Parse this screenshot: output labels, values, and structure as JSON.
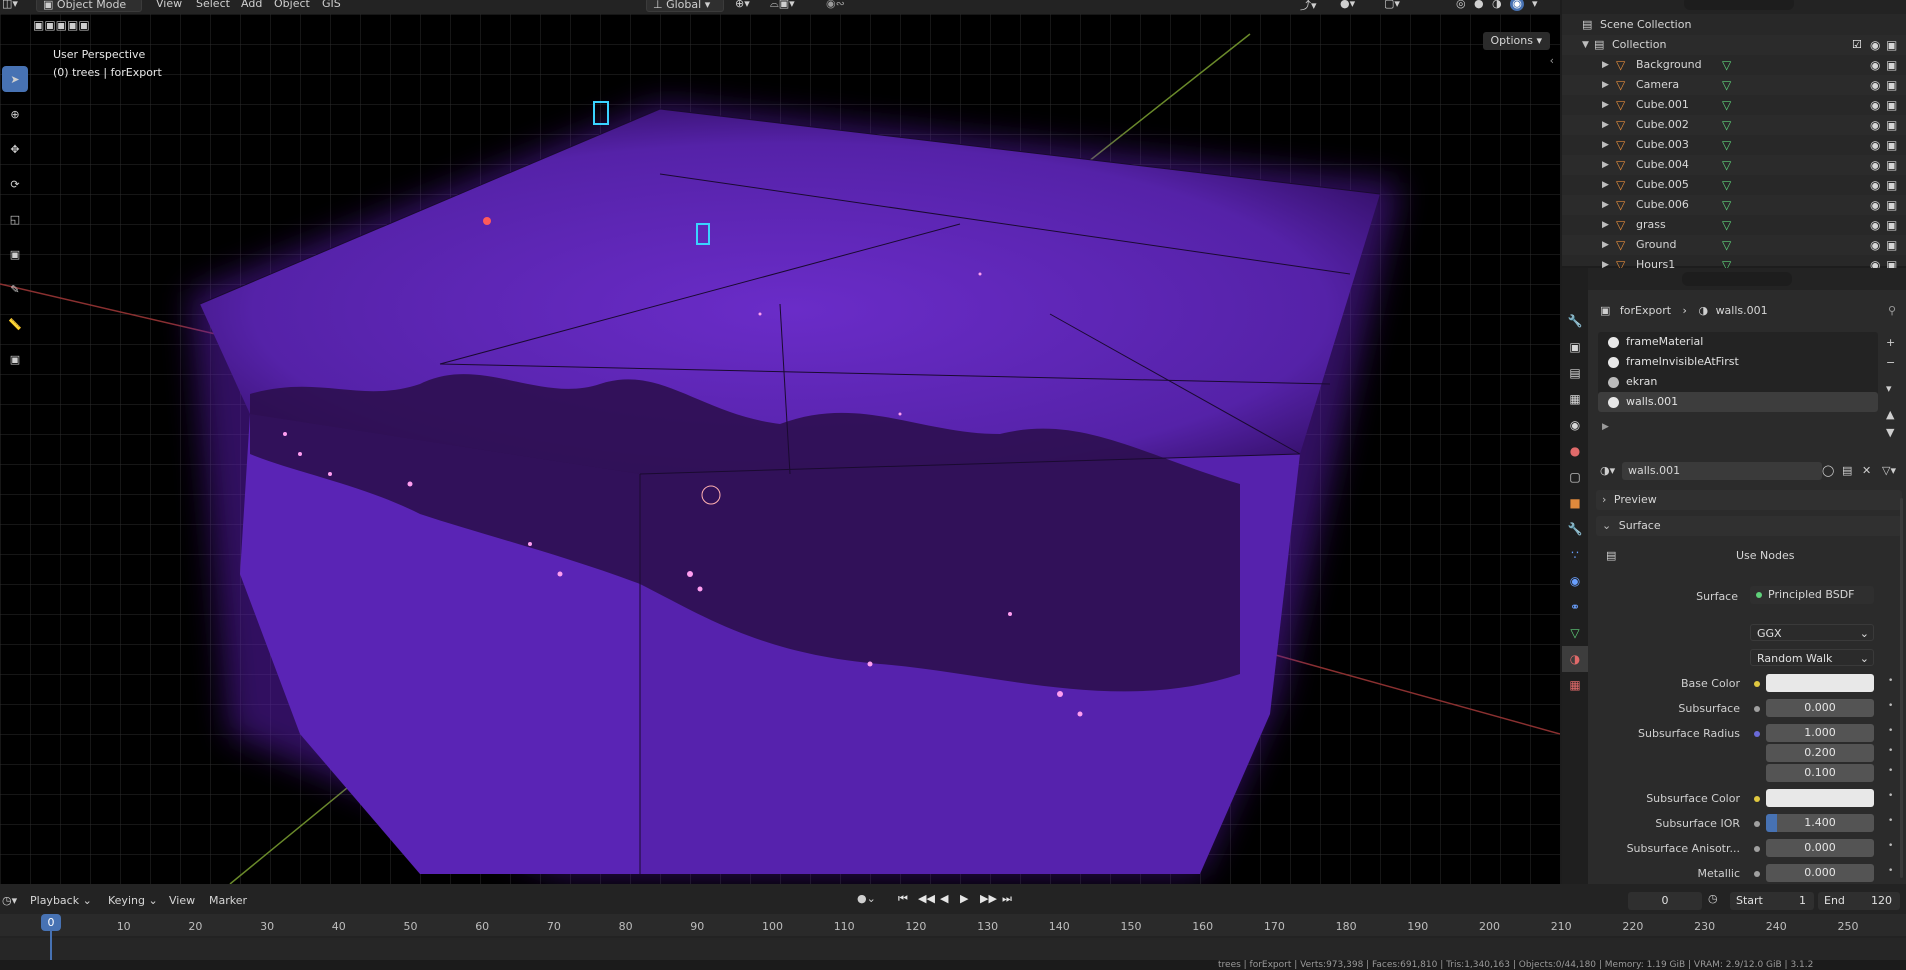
{
  "header": {
    "mode": "Object Mode",
    "menus": [
      "View",
      "Select",
      "Add",
      "Object",
      "GIS"
    ],
    "orientation": "Global",
    "options_label": "Options"
  },
  "viewport": {
    "perspective_label": "User Perspective",
    "context_label": "(0) trees | forExport"
  },
  "outliner": {
    "scene_collection": "Scene Collection",
    "collection": "Collection",
    "items": [
      {
        "name": "Background"
      },
      {
        "name": "Camera"
      },
      {
        "name": "Cube.001"
      },
      {
        "name": "Cube.002"
      },
      {
        "name": "Cube.003"
      },
      {
        "name": "Cube.004"
      },
      {
        "name": "Cube.005"
      },
      {
        "name": "Cube.006"
      },
      {
        "name": "grass"
      },
      {
        "name": "Ground"
      },
      {
        "name": "Hours1"
      }
    ]
  },
  "properties": {
    "breadcrumb_object": "forExport",
    "breadcrumb_material": "walls.001",
    "material_slots": [
      "frameMaterial",
      "frameInvisibleAtFirst",
      "ekran",
      "walls.001"
    ],
    "material_name": "walls.001",
    "preview_label": "Preview",
    "surface_label": "Surface",
    "use_nodes_label": "Use Nodes",
    "surface_field_label": "Surface",
    "surface_shader": "Principled BSDF",
    "distribution": "GGX",
    "subsurface_method": "Random Walk",
    "rows": [
      {
        "label": "Base Color",
        "value": ""
      },
      {
        "label": "Subsurface",
        "value": "0.000"
      },
      {
        "label": "Subsurface Radius",
        "value": "1.000"
      },
      {
        "label": "",
        "value": "0.200"
      },
      {
        "label": "",
        "value": "0.100"
      },
      {
        "label": "Subsurface Color",
        "value": ""
      },
      {
        "label": "Subsurface IOR",
        "value": "1.400"
      },
      {
        "label": "Subsurface Anisotr...",
        "value": "0.000"
      },
      {
        "label": "Metallic",
        "value": "0.000"
      }
    ]
  },
  "timeline": {
    "menus": [
      "Playback",
      "Keying",
      "View",
      "Marker"
    ],
    "current_frame": "0",
    "start_label": "Start",
    "start_value": "1",
    "end_label": "End",
    "end_value": "120",
    "ruler": [
      "0",
      "10",
      "20",
      "30",
      "40",
      "50",
      "60",
      "70",
      "80",
      "90",
      "100",
      "110",
      "120",
      "130",
      "140",
      "150",
      "160",
      "170",
      "180",
      "190",
      "200",
      "210",
      "220",
      "230",
      "240",
      "250"
    ]
  },
  "status_bar": {
    "text": "trees | forExport | Verts:973,398 | Faces:691,810 | Tris:1,340,163 | Objects:0/44,180 | Memory: 1.19 GiB | VRAM: 2.9/12.0 GiB | 3.1.2"
  }
}
